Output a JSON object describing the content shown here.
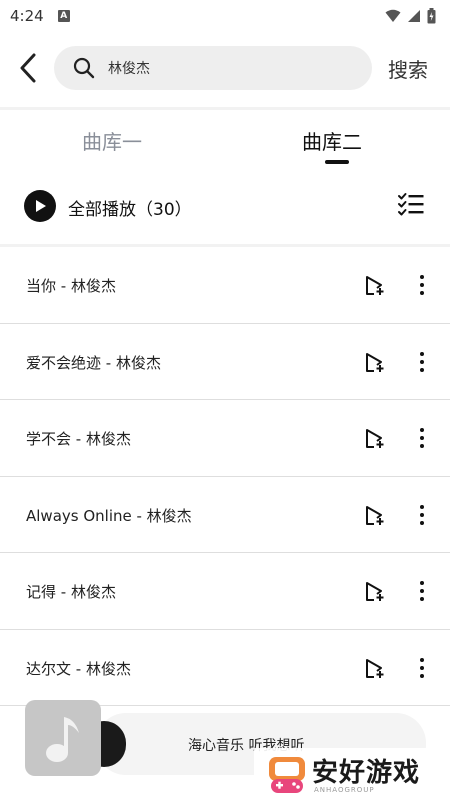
{
  "status_bar": {
    "time": "4:24",
    "notification_glyph": "A"
  },
  "header": {
    "search_value": "林俊杰",
    "search_button_label": "搜索"
  },
  "tabs": [
    {
      "label": "曲库一",
      "active": false
    },
    {
      "label": "曲库二",
      "active": true
    }
  ],
  "play_all": {
    "label": "全部播放（30）"
  },
  "songs": [
    {
      "title": "当你 - 林俊杰"
    },
    {
      "title": "爱不会绝迹 - 林俊杰"
    },
    {
      "title": "学不会 - 林俊杰"
    },
    {
      "title": "Always Online - 林俊杰"
    },
    {
      "title": "记得 - 林俊杰"
    },
    {
      "title": "达尔文 - 林俊杰"
    }
  ],
  "mini_player": {
    "text": "海心音乐 听我想听"
  },
  "watermark": {
    "text": "安好游戏",
    "sub": "ANHAOGROUP"
  },
  "colors": {
    "inactive_tab": "#8a8f99",
    "active_tab": "#111111",
    "search_bg": "#eeeeee",
    "divider": "#dedede"
  }
}
